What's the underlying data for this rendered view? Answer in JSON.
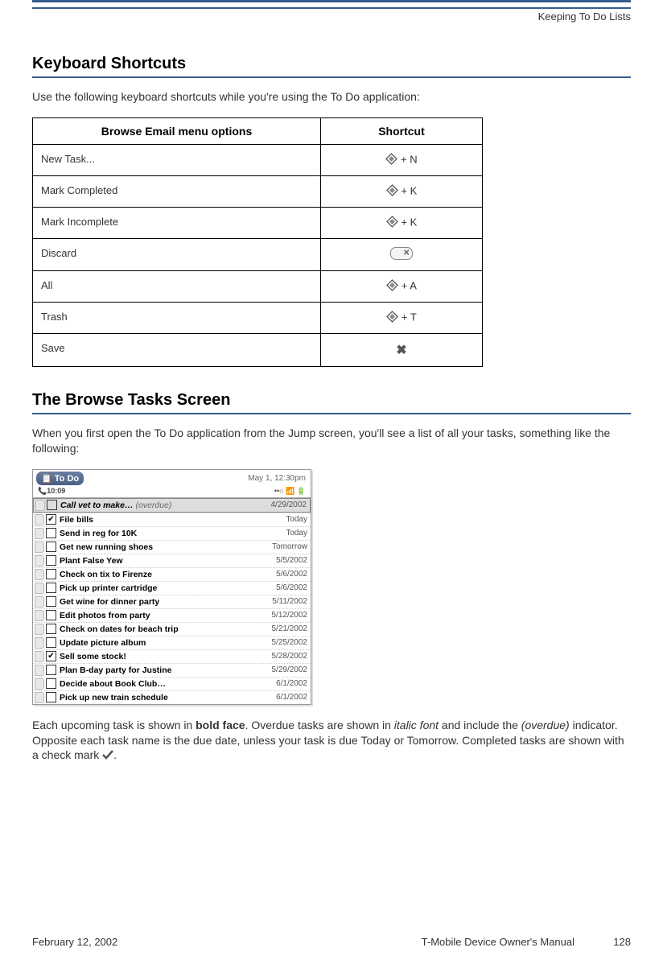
{
  "header": {
    "chapter": "Keeping To Do Lists"
  },
  "section1": {
    "title": "Keyboard Shortcuts",
    "intro": "Use the following keyboard shortcuts while you're using the To Do application:",
    "table": {
      "col1": "Browse Email menu options",
      "col2": "Shortcut",
      "rows": [
        {
          "label": "New Task...",
          "shortcut": " + N",
          "icon": "diamond"
        },
        {
          "label": "Mark Completed",
          "shortcut": " + K",
          "icon": "diamond"
        },
        {
          "label": "Mark Incomplete",
          "shortcut": " + K",
          "icon": "diamond"
        },
        {
          "label": "Discard",
          "shortcut": "",
          "icon": "discard"
        },
        {
          "label": "All",
          "shortcut": " + A",
          "icon": "diamond"
        },
        {
          "label": "Trash",
          "shortcut": " + T",
          "icon": "diamond"
        },
        {
          "label": "Save",
          "shortcut": "",
          "icon": "save"
        }
      ]
    }
  },
  "section2": {
    "title": "The Browse Tasks Screen",
    "intro": "When you first open the To Do application from the Jump screen, you'll see a list of all your tasks, something like the following:",
    "device": {
      "date": "May 1, 12:30pm",
      "title": "To Do",
      "time": "10:09",
      "tasks": [
        {
          "title": "Call vet to make…",
          "overdue": true,
          "date": "4/29/2002",
          "checked": false,
          "highlight": true
        },
        {
          "title": "File bills",
          "overdue": false,
          "date": "Today",
          "checked": true,
          "highlight": false
        },
        {
          "title": "Send in reg for 10K",
          "overdue": false,
          "date": "Today",
          "checked": false,
          "highlight": false
        },
        {
          "title": "Get new running shoes",
          "overdue": false,
          "date": "Tomorrow",
          "checked": false,
          "highlight": false
        },
        {
          "title": "Plant False Yew",
          "overdue": false,
          "date": "5/5/2002",
          "checked": false,
          "highlight": false
        },
        {
          "title": "Check on tix to Firenze",
          "overdue": false,
          "date": "5/6/2002",
          "checked": false,
          "highlight": false
        },
        {
          "title": "Pick up printer cartridge",
          "overdue": false,
          "date": "5/6/2002",
          "checked": false,
          "highlight": false
        },
        {
          "title": "Get wine for dinner party",
          "overdue": false,
          "date": "5/11/2002",
          "checked": false,
          "highlight": false
        },
        {
          "title": "Edit photos from party",
          "overdue": false,
          "date": "5/12/2002",
          "checked": false,
          "highlight": false
        },
        {
          "title": "Check on dates for beach trip",
          "overdue": false,
          "date": "5/21/2002",
          "checked": false,
          "highlight": false
        },
        {
          "title": "Update picture album",
          "overdue": false,
          "date": "5/25/2002",
          "checked": false,
          "highlight": false
        },
        {
          "title": "Sell some stock!",
          "overdue": false,
          "date": "5/28/2002",
          "checked": true,
          "highlight": false
        },
        {
          "title": "Plan B-day party for Justine",
          "overdue": false,
          "date": "5/29/2002",
          "checked": false,
          "highlight": false
        },
        {
          "title": "Decide about Book Club…",
          "overdue": false,
          "date": "6/1/2002",
          "checked": false,
          "highlight": false
        },
        {
          "title": "Pick up new train schedule",
          "overdue": false,
          "date": "6/1/2002",
          "checked": false,
          "highlight": false
        }
      ]
    },
    "para_parts": {
      "p1": "Each upcoming task is shown in ",
      "bold1": "bold face",
      "p2": ". Overdue tasks are shown in ",
      "italic1": "italic font",
      "p3": " and include the ",
      "italic2": "(overdue)",
      "p4": " indicator. Opposite each task name is the due date, unless your task is due Today or Tomorrow. Completed tasks are shown with a check mark ",
      "p5": "."
    }
  },
  "footer": {
    "date": "February 12, 2002",
    "manual": "T-Mobile Device Owner's Manual",
    "page": "128"
  }
}
